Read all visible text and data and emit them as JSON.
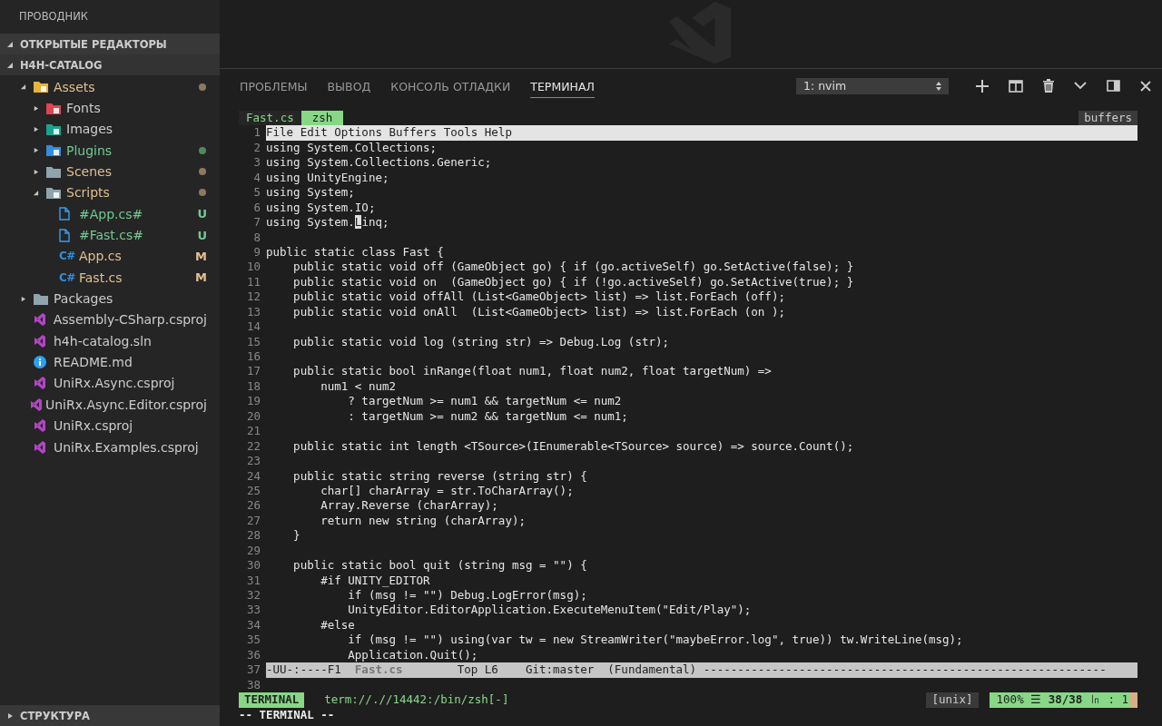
{
  "sidebar": {
    "title": "ПРОВОДНИК",
    "sections": [
      {
        "label": "ОТКРЫТЫЕ РЕДАКТОРЫ",
        "expanded": true
      },
      {
        "label": "H4H-CATALOG",
        "expanded": true
      }
    ],
    "tree": [
      {
        "name": "Assets",
        "kind": "assets",
        "expanded": true,
        "modified": true,
        "untracked": false,
        "dot": true,
        "children": [
          {
            "name": "Fonts",
            "kind": "fonts",
            "expanded": false,
            "modified": false,
            "untracked": false,
            "dot": false
          },
          {
            "name": "Images",
            "kind": "images",
            "expanded": false,
            "modified": false,
            "untracked": false,
            "dot": false
          },
          {
            "name": "Plugins",
            "kind": "plugins",
            "expanded": false,
            "modified": false,
            "untracked": true,
            "dot": true
          },
          {
            "name": "Scenes",
            "kind": "folder",
            "expanded": false,
            "modified": true,
            "untracked": false,
            "dot": true
          },
          {
            "name": "Scripts",
            "kind": "scripts",
            "expanded": true,
            "modified": true,
            "untracked": false,
            "dot": true,
            "children": [
              {
                "name": "#App.cs#",
                "kind": "file",
                "modified": false,
                "untracked": true,
                "badge": "U"
              },
              {
                "name": "#Fast.cs#",
                "kind": "file",
                "modified": false,
                "untracked": true,
                "badge": "U"
              },
              {
                "name": "App.cs",
                "kind": "csharp",
                "icon_label": "C#",
                "modified": true,
                "untracked": false,
                "badge": "M"
              },
              {
                "name": "Fast.cs",
                "kind": "csharp",
                "icon_label": "C#",
                "modified": true,
                "untracked": false,
                "badge": "M"
              }
            ]
          }
        ]
      },
      {
        "name": "Packages",
        "kind": "folder",
        "expanded": false,
        "modified": false,
        "untracked": false,
        "dot": false
      },
      {
        "name": "Assembly-CSharp.csproj",
        "kind": "project",
        "modified": false,
        "untracked": false
      },
      {
        "name": "h4h-catalog.sln",
        "kind": "project",
        "modified": false,
        "untracked": false
      },
      {
        "name": "README.md",
        "kind": "info",
        "modified": false,
        "untracked": false
      },
      {
        "name": "UniRx.Async.csproj",
        "kind": "project",
        "modified": false,
        "untracked": false
      },
      {
        "name": "UniRx.Async.Editor.csproj",
        "kind": "project",
        "modified": false,
        "untracked": false
      },
      {
        "name": "UniRx.csproj",
        "kind": "project",
        "modified": false,
        "untracked": false
      },
      {
        "name": "UniRx.Examples.csproj",
        "kind": "project",
        "modified": false,
        "untracked": false
      }
    ],
    "footer": {
      "label": "СТРУКТУРА",
      "expanded": false
    }
  },
  "panel": {
    "tabs": [
      {
        "label": "ПРОБЛЕМЫ",
        "selected": false
      },
      {
        "label": "ВЫВОД",
        "selected": false
      },
      {
        "label": "КОНСОЛЬ ОТЛАДКИ",
        "selected": false
      },
      {
        "label": "ТЕРМИНАЛ",
        "selected": true
      }
    ],
    "terminal_select": {
      "value": "1: nvim"
    },
    "actions": [
      {
        "kind": "plus"
      },
      {
        "kind": "split"
      },
      {
        "kind": "trash"
      },
      {
        "kind": "chevron"
      },
      {
        "kind": "panel"
      },
      {
        "kind": "close"
      }
    ]
  },
  "terminal": {
    "tabline": [
      {
        "label": "Fast.cs",
        "selected": false
      },
      {
        "label": "zsh",
        "selected": true
      }
    ],
    "tabline_right": "buffers",
    "lines": [
      {
        "number": "1",
        "kind": "menu",
        "text": "File Edit Options Buffers Tools Help"
      },
      {
        "number": "2",
        "kind": "code",
        "text": "using System.Collections;"
      },
      {
        "number": "3",
        "kind": "code",
        "text": "using System.Collections.Generic;"
      },
      {
        "number": "4",
        "kind": "code",
        "text": "using UnityEngine;"
      },
      {
        "number": "5",
        "kind": "code",
        "text": "using System;"
      },
      {
        "number": "6",
        "kind": "code",
        "text": "using System.IO;"
      },
      {
        "number": "7",
        "kind": "cursor",
        "segments": [
          "using System.",
          "L",
          "inq;"
        ]
      },
      {
        "number": "8",
        "kind": "code"
      },
      {
        "number": "9",
        "kind": "code",
        "text": "public static class Fast {"
      },
      {
        "number": "10",
        "kind": "code",
        "text": "    public static void off (GameObject go) { if (go.activeSelf) go.SetActive(false); }"
      },
      {
        "number": "11",
        "kind": "code",
        "text": "    public static void on  (GameObject go) { if (!go.activeSelf) go.SetActive(true); }"
      },
      {
        "number": "12",
        "kind": "code",
        "text": "    public static void offAll (List<GameObject> list) => list.ForEach (off);"
      },
      {
        "number": "13",
        "kind": "code",
        "text": "    public static void onAll  (List<GameObject> list) => list.ForEach (on );"
      },
      {
        "number": "14",
        "kind": "code"
      },
      {
        "number": "15",
        "kind": "code",
        "text": "    public static void log (string str) => Debug.Log (str);"
      },
      {
        "number": "16",
        "kind": "code"
      },
      {
        "number": "17",
        "kind": "code",
        "text": "    public static bool inRange(float num1, float num2, float targetNum) =>"
      },
      {
        "number": "18",
        "kind": "code",
        "text": "        num1 < num2"
      },
      {
        "number": "19",
        "kind": "code",
        "text": "            ? targetNum >= num1 && targetNum <= num2"
      },
      {
        "number": "20",
        "kind": "code",
        "text": "            : targetNum >= num2 && targetNum <= num1;"
      },
      {
        "number": "21",
        "kind": "code"
      },
      {
        "number": "22",
        "kind": "code",
        "text": "    public static int length <TSource>(IEnumerable<TSource> source) => source.Count();"
      },
      {
        "number": "23",
        "kind": "code"
      },
      {
        "number": "24",
        "kind": "code",
        "text": "    public static string reverse (string str) {"
      },
      {
        "number": "25",
        "kind": "code",
        "text": "        char[] charArray = str.ToCharArray();"
      },
      {
        "number": "26",
        "kind": "code",
        "text": "        Array.Reverse (charArray);"
      },
      {
        "number": "27",
        "kind": "code",
        "text": "        return new string (charArray);"
      },
      {
        "number": "28",
        "kind": "code",
        "text": "    }"
      },
      {
        "number": "29",
        "kind": "code"
      },
      {
        "number": "30",
        "kind": "code",
        "text": "    public static bool quit (string msg = \"\") {"
      },
      {
        "number": "31",
        "kind": "code",
        "text": "        #if UNITY_EDITOR"
      },
      {
        "number": "32",
        "kind": "code",
        "text": "            if (msg != \"\") Debug.LogError(msg);"
      },
      {
        "number": "33",
        "kind": "code",
        "text": "            UnityEditor.EditorApplication.ExecuteMenuItem(\"Edit/Play\");"
      },
      {
        "number": "34",
        "kind": "code",
        "text": "        #else"
      },
      {
        "number": "35",
        "kind": "code",
        "text": "            if (msg != \"\") using(var tw = new StreamWriter(\"maybeError.log\", true)) tw.WriteLine(msg);"
      },
      {
        "number": "36",
        "kind": "code",
        "text": "            Application.Quit();"
      },
      {
        "number": "37",
        "kind": "modeline",
        "segments": [
          "-UU-:----F1  ",
          "Fast.cs",
          "        Top L6    Git:master  (Fundamental) -----------------------------------------------------------"
        ]
      },
      {
        "number": "38",
        "kind": "code"
      }
    ],
    "statusline": {
      "mode": "TERMINAL",
      "file": "term://.//14442:/bin/zsh[-]",
      "format": "[unix]",
      "percent": "100%",
      "percent_icon": "☰",
      "position": "38/38",
      "ln_icon": "㏑",
      "colon": ":",
      "column": "1"
    },
    "command_line": "-- TERMINAL --"
  }
}
